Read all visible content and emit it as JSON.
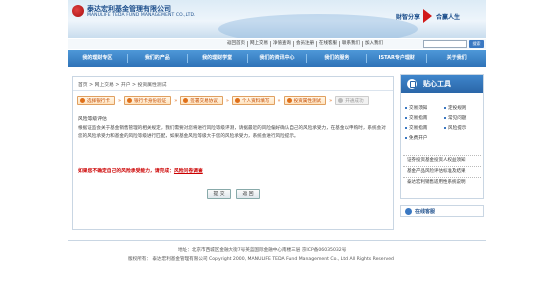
{
  "brand": {
    "name_cn": "泰达宏利基金管理有限公司",
    "name_en": "MANULIFE TEDA FUND MANAGEMENT CO.,LTD.",
    "slogan_left": "财智分享",
    "slogan_right": "合赢人生",
    "accent_color": "#2f73b8"
  },
  "toplinks": [
    "返回首页",
    "网上交易",
    "净值查询",
    "会员注册",
    "在线客服",
    "联系我们",
    "加入我们"
  ],
  "search": {
    "button_label": "搜索",
    "placeholder": ""
  },
  "nav": [
    "我的理财专区",
    "我们的产品",
    "我的理财学堂",
    "我们的资讯中心",
    "我们的服务",
    "ISTAR专户理财",
    "关于我们"
  ],
  "breadcrumb": "首页 > 网上交易 > 开户 > 投资属性测试",
  "steps": [
    {
      "label": "选择银行卡",
      "state": "done"
    },
    {
      "label": "银行卡身份验证",
      "state": "done"
    },
    {
      "label": "签署交易协议",
      "state": "done"
    },
    {
      "label": "个人资料填写",
      "state": "done"
    },
    {
      "label": "投资属性测试",
      "state": "done"
    },
    {
      "label": "开通成功",
      "state": "todo"
    }
  ],
  "form": {
    "title": "风险等级评估",
    "paragraph": "根据证监会关于基金销售管理的相关规定，我们需要对您将进行风险等级评测，请据最近的风险偏好确认自己的风险承受力，在基金以申购时，系统会对您的风险承受力和基金的风险等级进行匹配，如果基金风险等级大于您的风险承受力，系统会进行风险提示。",
    "warning_prefix": "如果您不确定自己的风险承受能力，请完成：",
    "warning_link": "风险问卷调查",
    "ok_label": "提 交",
    "back_label": "返 回"
  },
  "side": {
    "title": "贴心工具",
    "grid": [
      [
        "交易须知",
        "定投规则"
      ],
      [
        "交易指南",
        "常见问题"
      ],
      [
        "交易指南",
        "风险提示"
      ],
      [
        "免费开户",
        ""
      ]
    ],
    "list": [
      "证券投资基金投资人权益须知",
      "基金产品风险评估标准及结果",
      "泰达宏利销售适用性系统说明"
    ]
  },
  "online_service": "在线客服",
  "footer": {
    "address": "地址：北京市西城区金融大街7号英蓝国际金融中心南楼三层  京ICP备06035032号",
    "copyright": "版权所有：  泰达宏利基金管理有限公司  Copyright 2000, MANULIFE TEDA Fund Management Co., Ltd All Rights Reserved"
  }
}
